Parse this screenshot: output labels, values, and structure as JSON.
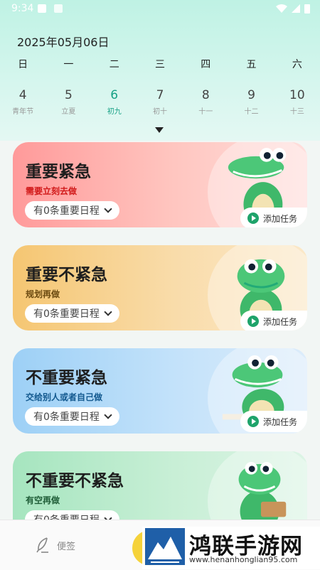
{
  "status": {
    "time": "9:34"
  },
  "calendar": {
    "date": "2025年05月06日",
    "weekdays": [
      "日",
      "一",
      "二",
      "三",
      "四",
      "五",
      "六"
    ],
    "days": [
      {
        "num": "4",
        "lunar": "青年节"
      },
      {
        "num": "5",
        "lunar": "立夏"
      },
      {
        "num": "6",
        "lunar": "初九"
      },
      {
        "num": "7",
        "lunar": "初十"
      },
      {
        "num": "8",
        "lunar": "十一"
      },
      {
        "num": "9",
        "lunar": "十二"
      },
      {
        "num": "10",
        "lunar": "十三"
      }
    ]
  },
  "cards": [
    {
      "title": "重要紧急",
      "subtitle": "需要立刻去做",
      "count": "有0条重要日程",
      "add": "添加任务"
    },
    {
      "title": "重要不紧急",
      "subtitle": "规划再做",
      "count": "有0条重要日程",
      "add": "添加任务"
    },
    {
      "title": "不重要紧急",
      "subtitle": "交给别人或者自己做",
      "count": "有0条重要日程",
      "add": "添加任务"
    },
    {
      "title": "不重要不紧急",
      "subtitle": "有空再做",
      "count": "有0条重要日程"
    }
  ],
  "bottom_nav": {
    "note": "便签"
  },
  "watermark": {
    "name": "鸿联手游网",
    "url": "www.henanhonglian95.com"
  },
  "colors": {
    "accent": "#16a085",
    "add_green": "#1ea36a"
  }
}
